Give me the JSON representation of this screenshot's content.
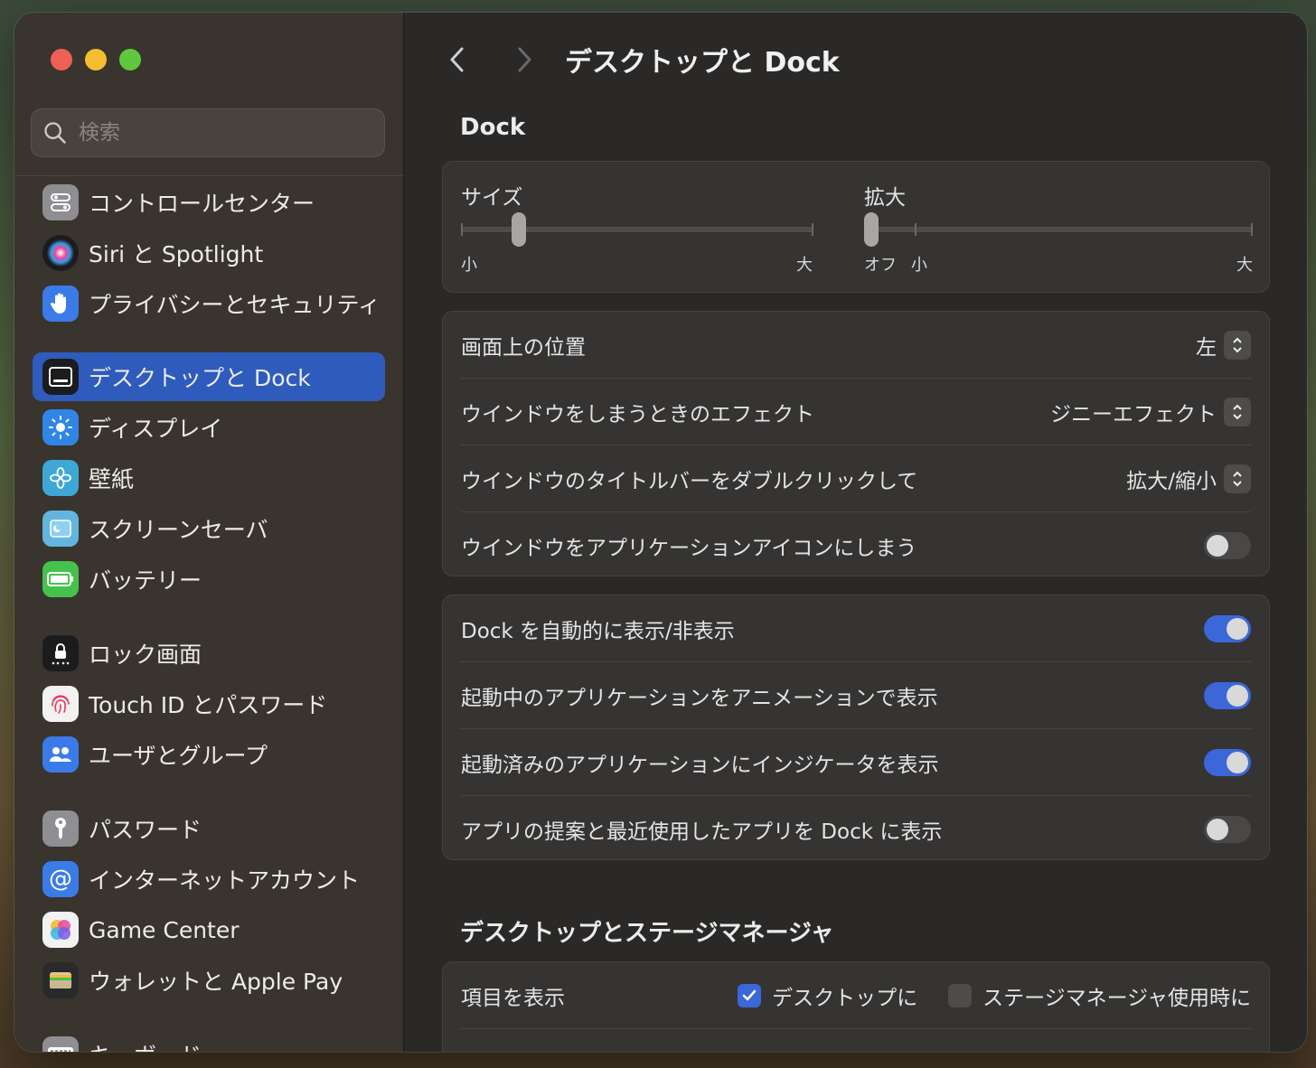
{
  "window": {
    "title": "デスクトップと Dock"
  },
  "search": {
    "placeholder": "検索"
  },
  "sidebar": {
    "items": [
      {
        "label": "コントロールセンター",
        "icon": "control-center-icon",
        "color": "#8e8e93"
      },
      {
        "label": "Siri と Spotlight",
        "icon": "siri-icon",
        "color": "#2a2a2a"
      },
      {
        "label": "プライバシーとセキュリティ",
        "icon": "hand-icon",
        "color": "#3a7be8"
      },
      {
        "label": "デスクトップと Dock",
        "icon": "dock-icon",
        "color": "#1c1c1e",
        "active": true
      },
      {
        "label": "ディスプレイ",
        "icon": "sun-icon",
        "color": "#2f86e6"
      },
      {
        "label": "壁紙",
        "icon": "flower-icon",
        "color": "#3ea7d6"
      },
      {
        "label": "スクリーンセーバ",
        "icon": "screensaver-icon",
        "color": "#62b6de"
      },
      {
        "label": "バッテリー",
        "icon": "battery-icon",
        "color": "#45c24d"
      },
      {
        "label": "ロック画面",
        "icon": "lock-icon",
        "color": "#1c1c1e"
      },
      {
        "label": "Touch ID とパスワード",
        "icon": "fingerprint-icon",
        "color": "#f2f2f2"
      },
      {
        "label": "ユーザとグループ",
        "icon": "users-icon",
        "color": "#3a7be8"
      },
      {
        "label": "パスワード",
        "icon": "key-icon",
        "color": "#8e8e93"
      },
      {
        "label": "インターネットアカウント",
        "icon": "at-icon",
        "color": "#3a7be8"
      },
      {
        "label": "Game Center",
        "icon": "game-center-icon",
        "color": "#f2f2f2"
      },
      {
        "label": "ウォレットと Apple Pay",
        "icon": "wallet-icon",
        "color": "#2a2a2a"
      },
      {
        "label": "キーボード",
        "icon": "keyboard-icon",
        "color": "#8e8e93"
      }
    ]
  },
  "main": {
    "dock_heading": "Dock",
    "size": {
      "label": "サイズ",
      "min": "小",
      "max": "大",
      "value": 0.15
    },
    "magnify": {
      "label": "拡大",
      "off": "オフ",
      "min": "小",
      "max": "大",
      "value": 0
    },
    "position": {
      "label": "画面上の位置",
      "value": "左"
    },
    "minimize": {
      "label": "ウインドウをしまうときのエフェクト",
      "value": "ジニーエフェクト"
    },
    "dblclick": {
      "label": "ウインドウのタイトルバーをダブルクリックして",
      "value": "拡大/縮小"
    },
    "minimize_to_icon": {
      "label": "ウインドウをアプリケーションアイコンにしまう",
      "on": false
    },
    "autohide": {
      "label": "Dock を自動的に表示/非表示",
      "on": true
    },
    "animate": {
      "label": "起動中のアプリケーションをアニメーションで表示",
      "on": true
    },
    "indicators": {
      "label": "起動済みのアプリケーションにインジケータを表示",
      "on": true
    },
    "recents": {
      "label": "アプリの提案と最近使用したアプリを Dock に表示",
      "on": false
    },
    "stage_heading": "デスクトップとステージマネージャ",
    "show_items": {
      "label": "項目を表示",
      "desktop": {
        "label": "デスクトップに",
        "checked": true
      },
      "stage": {
        "label": "ステージマネージャ使用時に",
        "checked": false
      }
    }
  },
  "colors": {
    "accent": "#3b67d8",
    "sidebar_active": "#2f5bbd"
  }
}
